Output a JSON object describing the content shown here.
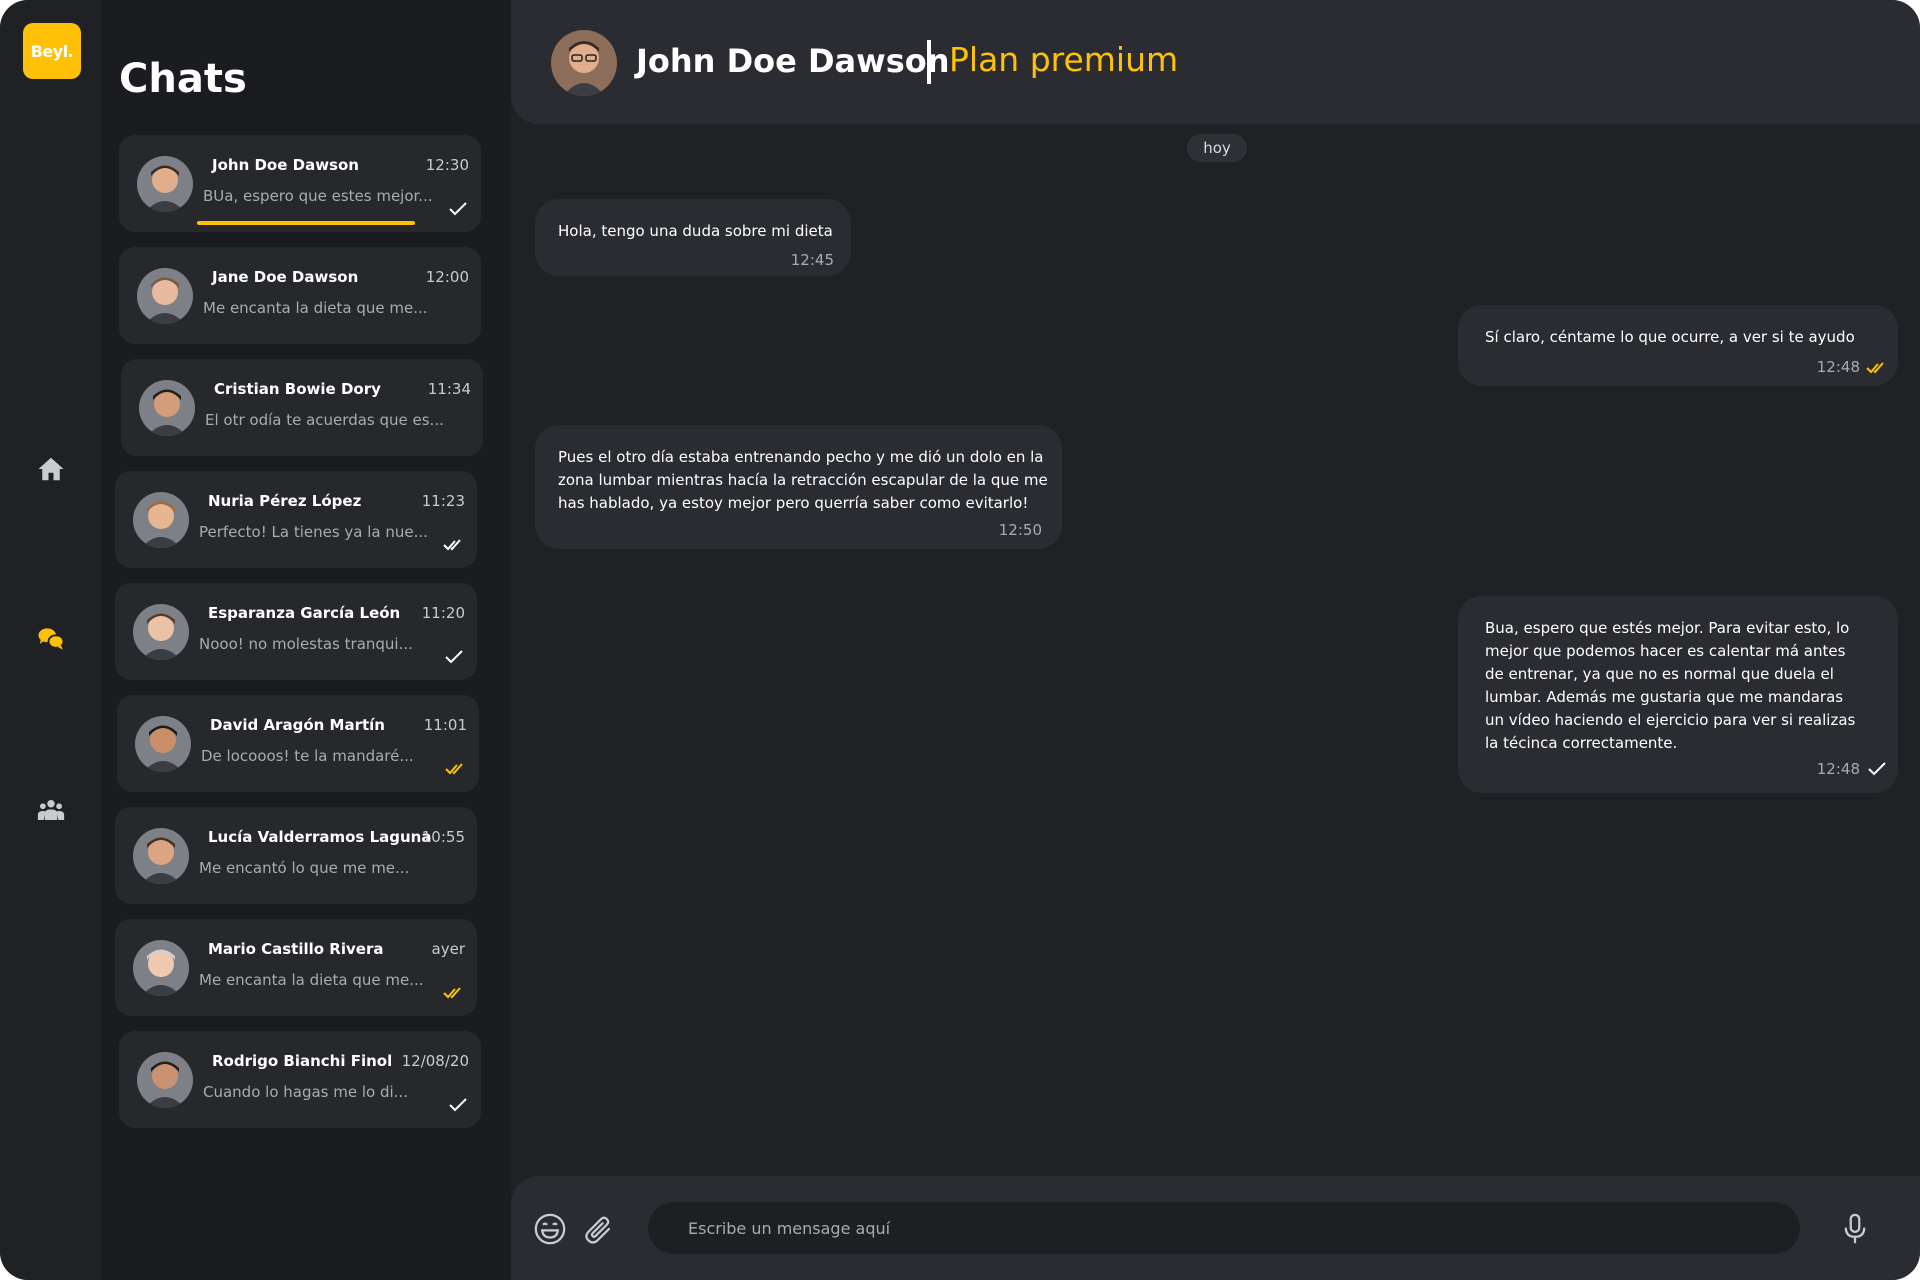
{
  "app": {
    "logo_text": "Beyl.",
    "brand_color": "#ffc107"
  },
  "rail": {
    "icons": [
      "home-icon",
      "chat-icon",
      "users-icon"
    ],
    "active_icon": "chat-icon"
  },
  "sidebar": {
    "title": "Chats",
    "chats": [
      {
        "name": "John Doe Dawson",
        "time": "12:30",
        "preview": "BUa, espero que estes mejor...",
        "status": "sent",
        "active": true
      },
      {
        "name": "Jane Doe Dawson",
        "time": "12:00",
        "preview": "Me encanta la dieta que me...",
        "status": "none",
        "active": false
      },
      {
        "name": "Cristian Bowie Dory",
        "time": "11:34",
        "preview": "El otr odía te acuerdas que es...",
        "status": "none",
        "active": false
      },
      {
        "name": "Nuria Pérez López",
        "time": "11:23",
        "preview": "Perfecto! La tienes ya la nue...",
        "status": "delivered",
        "active": false
      },
      {
        "name": "Esparanza García León",
        "time": "11:20",
        "preview": "Nooo! no molestas tranqui...",
        "status": "sent",
        "active": false
      },
      {
        "name": "David Aragón Martín",
        "time": "11:01",
        "preview": "De locooos! te la mandaré...",
        "status": "read",
        "active": false
      },
      {
        "name": "Lucía Valderramos Laguna",
        "time": "10:55",
        "preview": "Me encantó lo que me me...",
        "status": "none",
        "active": false
      },
      {
        "name": "Mario Castillo Rivera",
        "time": "ayer",
        "preview": "Me encanta la dieta que me...",
        "status": "read",
        "active": false
      },
      {
        "name": "Rodrigo Bianchi Finol",
        "time": "12/08/20",
        "preview": "Cuando lo hagas me lo di...",
        "status": "sent",
        "active": false
      }
    ]
  },
  "header": {
    "contact_name": "John Doe Dawson",
    "plan": "Plan premium"
  },
  "conversation": {
    "day_label": "hoy",
    "messages": [
      {
        "direction": "incoming",
        "lines": [
          "Hola, tengo una duda sobre mi dieta"
        ],
        "time": "12:45",
        "status": "none"
      },
      {
        "direction": "outgoing",
        "lines": [
          "Sí claro, céntame lo que ocurre,  a ver si te ayudo"
        ],
        "time": "12:48",
        "status": "read"
      },
      {
        "direction": "incoming",
        "lines": [
          "Pues el otro día estaba entrenando pecho y me dió un dolo en la",
          "zona lumbar mientras hacía la retracción escapular de la que me",
          "has hablado, ya estoy mejor pero querría saber como evitarlo!"
        ],
        "time": "12:50",
        "status": "none"
      },
      {
        "direction": "outgoing",
        "lines": [
          "Bua, espero que estés mejor. Para evitar esto, lo",
          "mejor que podemos hacer es calentar má antes",
          "de entrenar, ya que no es normal que duela el",
          "lumbar. Además me gustaria que me mandaras",
          "un vídeo haciendo el ejercicio para ver si realizas",
          "la técinca correctamente."
        ],
        "time": "12:48",
        "status": "sent"
      }
    ]
  },
  "composer": {
    "placeholder": "Escribe un mensage aquí",
    "icons": [
      "emoji-icon",
      "paperclip-icon",
      "microphone-icon"
    ]
  },
  "colors": {
    "background": "#1f2125",
    "sidebar": "#1b1c20",
    "card": "#26282c",
    "panel": "#2a2c31",
    "accent": "#ffc107"
  }
}
